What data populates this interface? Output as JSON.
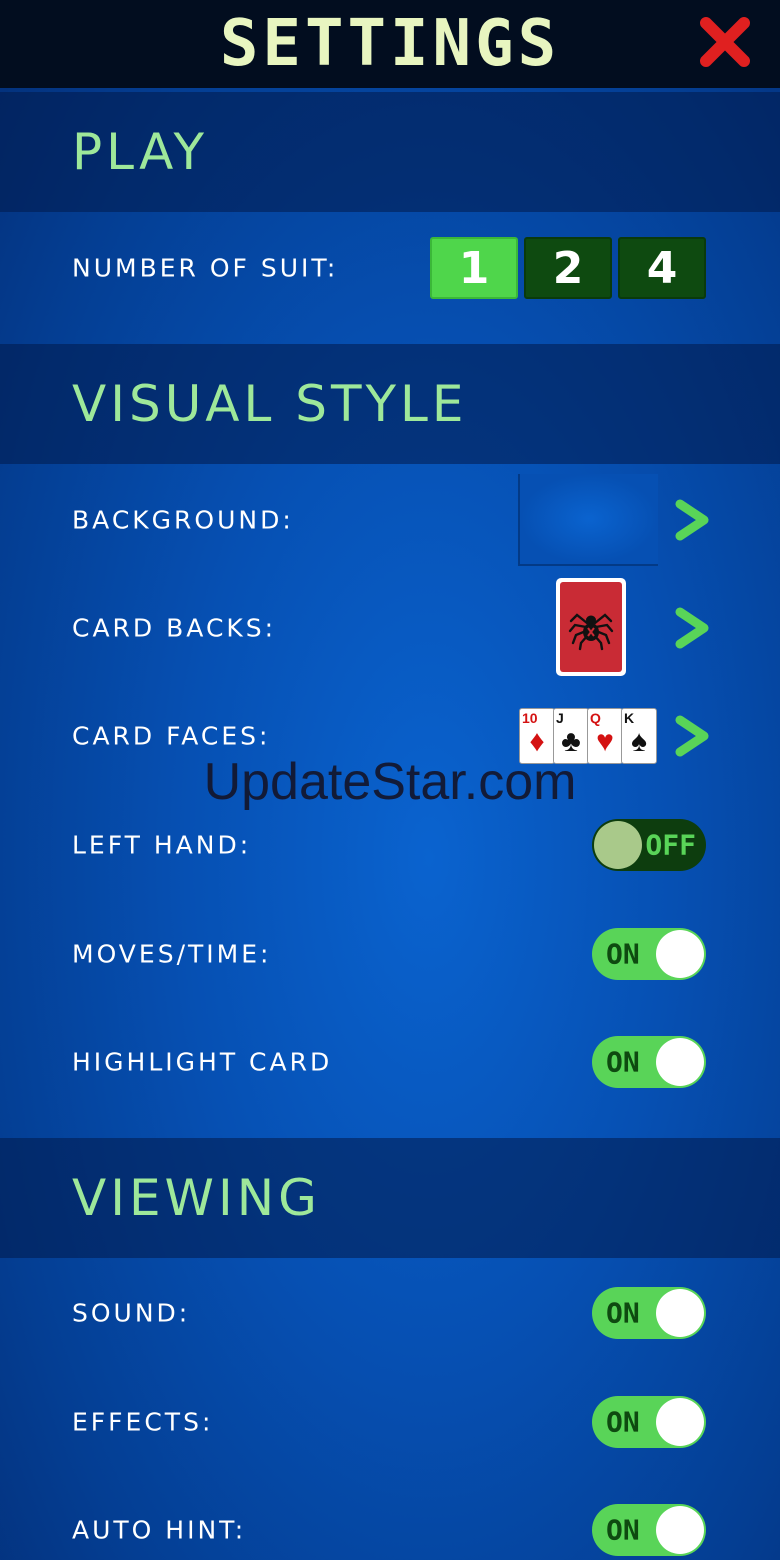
{
  "header": {
    "title": "SETTINGS"
  },
  "sections": {
    "play": {
      "title": "PLAY"
    },
    "visual": {
      "title": "VISUAL STYLE"
    },
    "viewing": {
      "title": "VIEWING"
    }
  },
  "play": {
    "suits_label": "NUMBER OF SUIT:",
    "suit_options": [
      "1",
      "2",
      "4"
    ],
    "suit_selected": "1"
  },
  "visual": {
    "background_label": "BACKGROUND:",
    "card_backs_label": "CARD BACKS:",
    "card_faces_label": "CARD FACES:",
    "card_faces_preview": [
      {
        "rank": "10",
        "suit": "♦"
      },
      {
        "rank": "J",
        "suit": "♣"
      },
      {
        "rank": "Q",
        "suit": "♥"
      },
      {
        "rank": "K",
        "suit": "♠"
      }
    ],
    "left_hand": {
      "label": "LEFT HAND:",
      "state": "OFF"
    },
    "moves_time": {
      "label": "MOVES/TIME:",
      "state": "ON"
    },
    "highlight_card": {
      "label": "HIGHLIGHT CARD",
      "state": "ON"
    }
  },
  "viewing": {
    "sound": {
      "label": "SOUND:",
      "state": "ON"
    },
    "effects": {
      "label": "EFFECTS:",
      "state": "ON"
    },
    "auto_hint": {
      "label": "AUTO HINT:",
      "state": "ON"
    }
  },
  "watermark": "UpdateStar.com",
  "colors": {
    "accent_green": "#59d458",
    "section_title": "#9ee89a",
    "close_red": "#e02020"
  }
}
